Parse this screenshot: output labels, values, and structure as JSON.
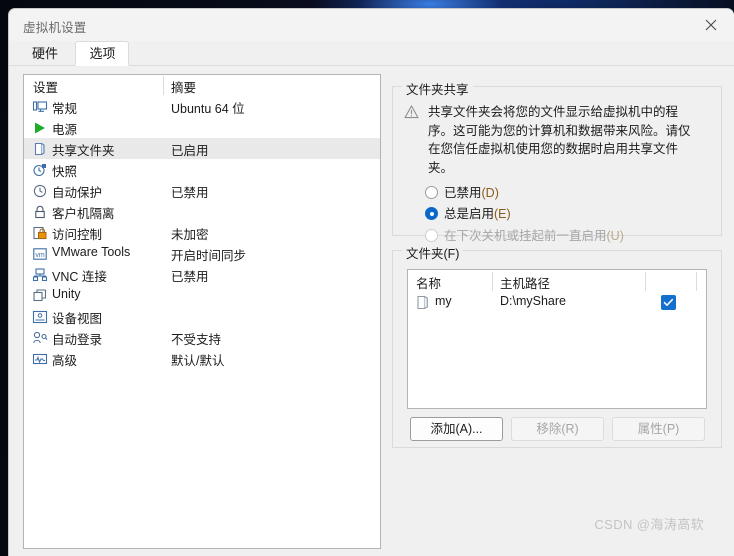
{
  "window": {
    "title": "虚拟机设置",
    "close_icon": "close-icon"
  },
  "tabs": [
    {
      "label": "硬件",
      "selected": false
    },
    {
      "label": "选项",
      "selected": true
    }
  ],
  "settings_list": {
    "columns": [
      "设置",
      "摘要"
    ],
    "rows": [
      {
        "icon": "monitor-icon",
        "label": "常规",
        "summary": "Ubuntu 64 位",
        "selected": false
      },
      {
        "icon": "play-icon",
        "label": "电源",
        "summary": "",
        "selected": false
      },
      {
        "icon": "shared-folder-icon",
        "label": "共享文件夹",
        "summary": "已启用",
        "selected": true
      },
      {
        "icon": "snapshot-clock-icon",
        "label": "快照",
        "summary": "",
        "selected": false
      },
      {
        "icon": "clock-icon",
        "label": "自动保护",
        "summary": "已禁用",
        "selected": false
      },
      {
        "icon": "lock-icon",
        "label": "客户机隔离",
        "summary": "",
        "selected": false
      },
      {
        "icon": "access-lock-icon",
        "label": "访问控制",
        "summary": "未加密",
        "selected": false
      },
      {
        "icon": "vmware-tools-icon",
        "label": "VMware Tools",
        "summary": "开启时间同步",
        "selected": false
      },
      {
        "icon": "vnc-icon",
        "label": "VNC 连接",
        "summary": "已禁用",
        "selected": false
      },
      {
        "icon": "unity-icon",
        "label": "Unity",
        "summary": "",
        "selected": false
      },
      {
        "icon": "device-view-icon",
        "label": "设备视图",
        "summary": "",
        "selected": false
      },
      {
        "icon": "auto-login-icon",
        "label": "自动登录",
        "summary": "不受支持",
        "selected": false
      },
      {
        "icon": "advanced-icon",
        "label": "高级",
        "summary": "默认/默认",
        "selected": false
      }
    ]
  },
  "folder_sharing": {
    "group_title": "文件夹共享",
    "warning_icon": "warning-triangle-icon",
    "warning_text": "共享文件夹会将您的文件显示给虚拟机中的程序。这可能为您的计算机和数据带来风险。请仅在您信任虚拟机使用您的数据时启用共享文件夹。",
    "options": [
      {
        "label": "已禁用",
        "mnemonic": "(D)",
        "checked": false,
        "disabled": false
      },
      {
        "label": "总是启用",
        "mnemonic": "(E)",
        "checked": true,
        "disabled": false
      },
      {
        "label": "在下次关机或挂起前一直启用",
        "mnemonic": "(U)",
        "checked": false,
        "disabled": true
      }
    ]
  },
  "folders": {
    "group_title": "文件夹(F)",
    "columns": {
      "name": "名称",
      "path": "主机路径"
    },
    "rows": [
      {
        "icon": "folder-icon",
        "name": "my",
        "path": "D:\\myShare",
        "enabled": true
      }
    ],
    "buttons": [
      {
        "id": "add",
        "label": "添加(A)...",
        "disabled": false,
        "focused": true
      },
      {
        "id": "remove",
        "label": "移除(R)",
        "disabled": true,
        "focused": false
      },
      {
        "id": "props",
        "label": "属性(P)",
        "disabled": true,
        "focused": false
      }
    ]
  },
  "watermark": "CSDN @海涛高软",
  "colors": {
    "accent": "#0a69c8",
    "checkbox": "#1370cc",
    "selection": "#e9e9e9",
    "window_bg": "#f0f0f0",
    "list_bg": "#ffffff"
  }
}
